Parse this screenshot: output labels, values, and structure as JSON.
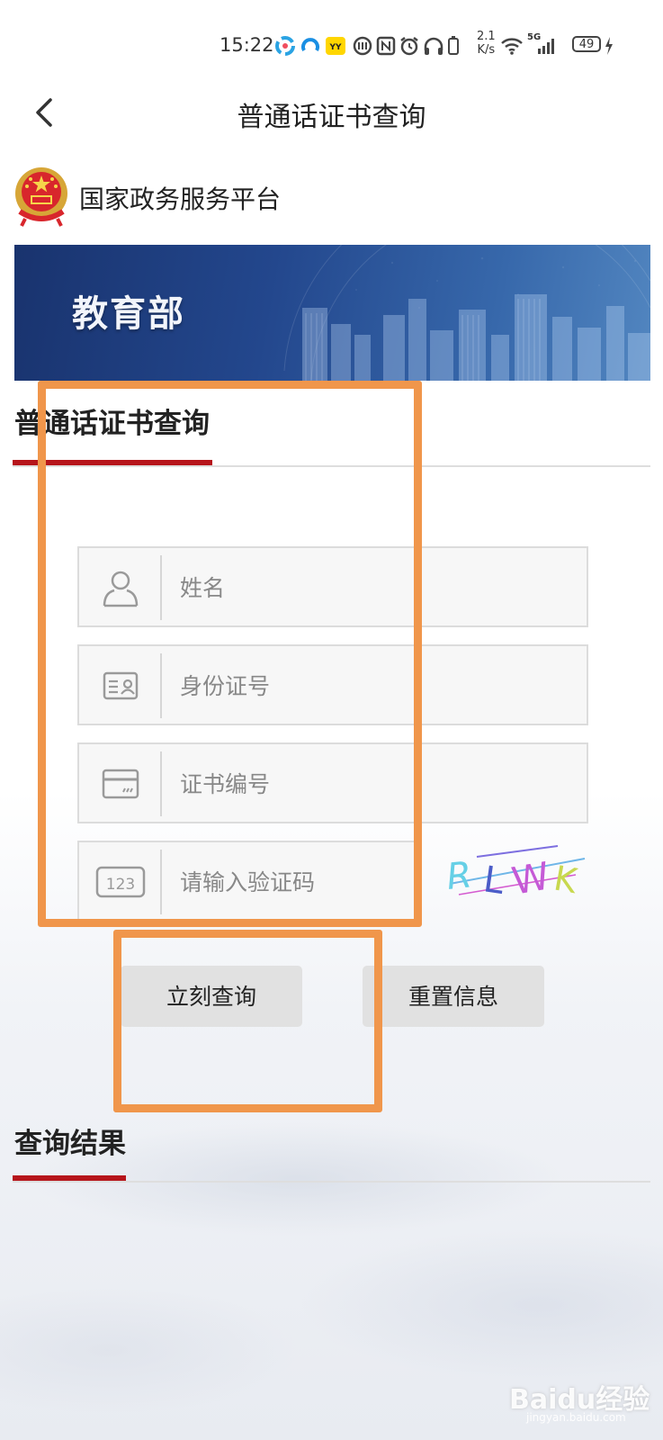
{
  "status_bar": {
    "time": "15:22",
    "speed_value": "2.1",
    "speed_unit": "K/s",
    "signal_label": "5G",
    "battery": "49"
  },
  "nav": {
    "title": "普通话证书查询",
    "back_icon": "chevron-left-icon"
  },
  "platform": {
    "name": "国家政务服务平台",
    "emblem_icon": "national-emblem-icon"
  },
  "banner": {
    "title": "教育部"
  },
  "form_section": {
    "title": "普通话证书查询"
  },
  "form": {
    "fields": [
      {
        "icon": "person-icon",
        "placeholder": "姓名",
        "value": ""
      },
      {
        "icon": "id-card-icon",
        "placeholder": "身份证号",
        "value": ""
      },
      {
        "icon": "card-icon",
        "placeholder": "证书编号",
        "value": ""
      },
      {
        "icon": "number-123-icon",
        "placeholder": "请输入验证码",
        "value": ""
      }
    ],
    "captcha_text": "RLWK",
    "submit_label": "立刻查询",
    "reset_label": "重置信息"
  },
  "results_section": {
    "title": "查询结果"
  },
  "watermark": {
    "brand": "Baidu经验",
    "url": "jingyan.baidu.com"
  },
  "colors": {
    "accent_red": "#b6151b",
    "annotation_orange": "#f0964b",
    "banner_blue": "#23478d"
  }
}
